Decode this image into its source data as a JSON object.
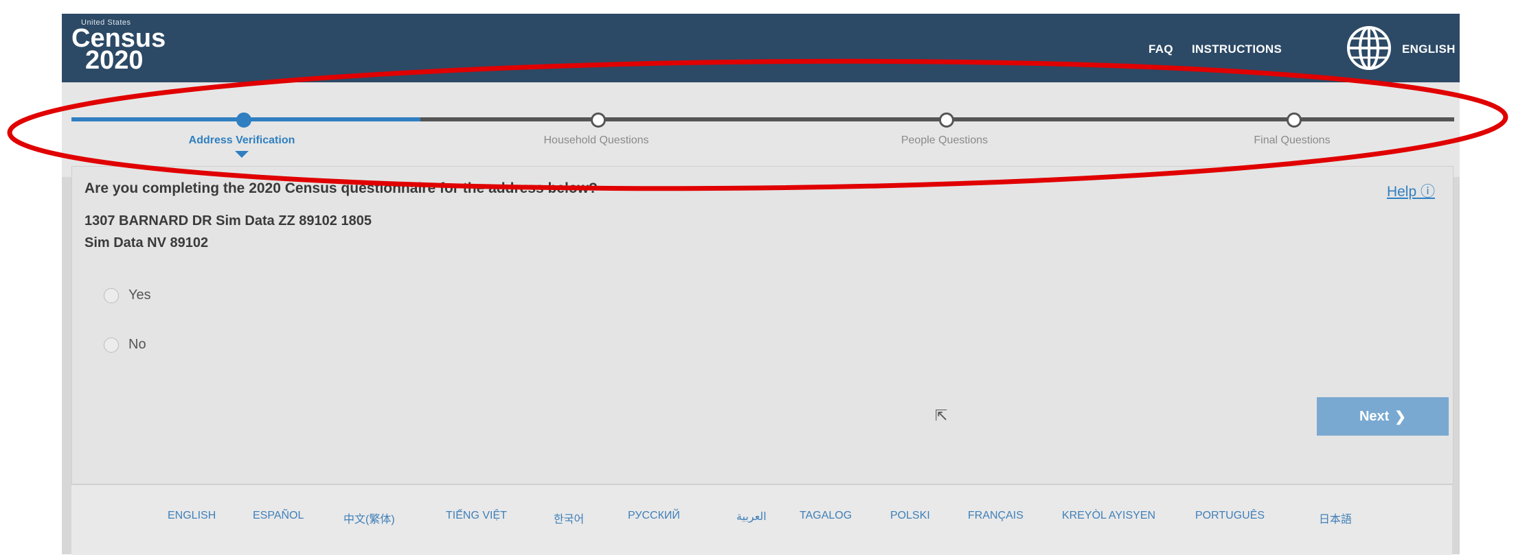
{
  "header": {
    "logo_small": "United States",
    "logo_line1": "Census",
    "logo_line2": "2020",
    "faq": "FAQ",
    "instructions": "INSTRUCTIONS",
    "language": "ENGLISH",
    "globe_icon": "globe-icon"
  },
  "progress": {
    "steps": [
      {
        "label": "Address Verification",
        "state": "current"
      },
      {
        "label": "Household Questions",
        "state": "upcoming"
      },
      {
        "label": "People Questions",
        "state": "upcoming"
      },
      {
        "label": "Final Questions",
        "state": "upcoming"
      }
    ]
  },
  "main": {
    "question": "Are you completing the 2020 Census questionnaire for the address below?",
    "help_label": "Help",
    "address_line1": "1307 BARNARD DR Sim Data ZZ 89102 1805",
    "address_line2": "Sim Data NV 89102",
    "options": [
      "Yes",
      "No"
    ],
    "next_label": "Next"
  },
  "languages": [
    "ENGLISH",
    "ESPAÑOL",
    "中文(繁体)",
    "TIẾNG VIỆT",
    "한국어",
    "РУССКИЙ",
    "العربية",
    "TAGALOG",
    "POLSKI",
    "FRANÇAIS",
    "KREYÒL AYISYEN",
    "PORTUGUÊS",
    "日本語"
  ],
  "colors": {
    "header_bg": "#2c4a66",
    "accent": "#2f7fc1",
    "annotation": "#e00000"
  }
}
